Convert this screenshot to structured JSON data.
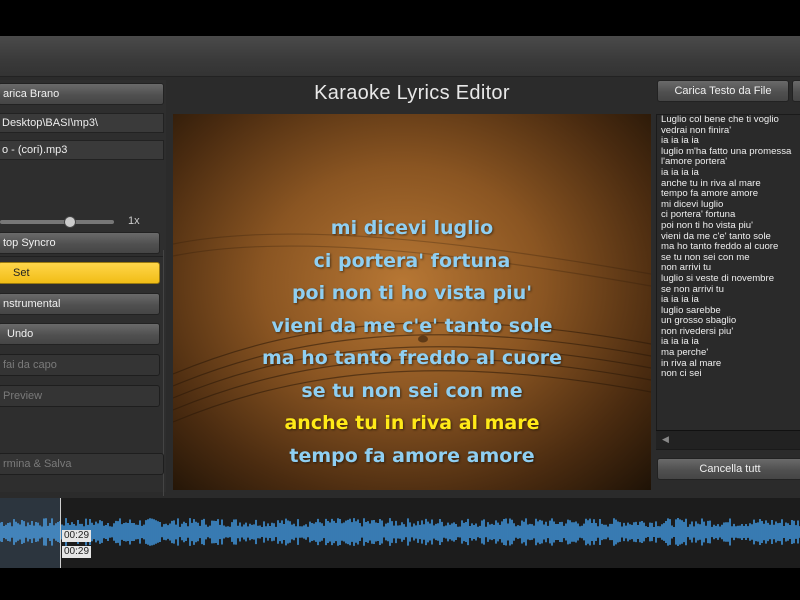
{
  "app": {
    "title": "Karaoke Lyrics Editor"
  },
  "left_panel": {
    "load_song_button": "arica Brano",
    "folder_path": "Desktop\\BASI\\mp3\\",
    "file_name": "o - (cori).mp3",
    "speed_label": "1x",
    "speed_value": 0.6,
    "stop_sync_button": "top Syncro",
    "set_button": "Set",
    "instrumental_button": "nstrumental",
    "undo_button": "Undo",
    "restart_button": "fai da capo",
    "preview_button": "Preview",
    "finish_save_button": "rmina & Salva"
  },
  "preview": {
    "lines": [
      "mi dicevi luglio",
      "ci portera' fortuna",
      "poi non ti ho vista piu'",
      "vieni da me c'e' tanto sole",
      "ma ho tanto freddo al cuore",
      "se tu non sei con me",
      "anche tu in riva al mare",
      "tempo fa amore amore"
    ],
    "active_line_index": 6,
    "colors": {
      "normal": "#8fcff2",
      "active": "#ffea18"
    }
  },
  "right_panel": {
    "load_text_button": "Carica Testo da File",
    "clear_all_button": "Cancella tutt",
    "text_lines": [
      "Luglio col bene che ti voglio",
      "vedrai non finira'",
      " ia ia ia ia",
      "luglio m'ha fatto una promessa",
      "l'amore portera'",
      " ia ia ia ia",
      "anche tu in riva al mare",
      "tempo fa amore amore",
      "mi dicevi luglio",
      "ci portera' fortuna",
      "poi non ti ho vista piu'",
      "vieni da me c'e' tanto sole",
      "ma ho tanto freddo al cuore",
      "se tu non sei con me",
      "non arrivi tu",
      "luglio si veste di novembre",
      "se non arrivi tu",
      " ia ia ia ia",
      "luglio sarebbe",
      "un grosso sbaglio",
      "non rivedersi piu'",
      "ia ia ia ia",
      "ma perche'",
      "in riva al mare",
      "non ci sei"
    ]
  },
  "waveform": {
    "time_top": "00:29",
    "time_bottom": "00:29",
    "color": "#3f93d8"
  }
}
